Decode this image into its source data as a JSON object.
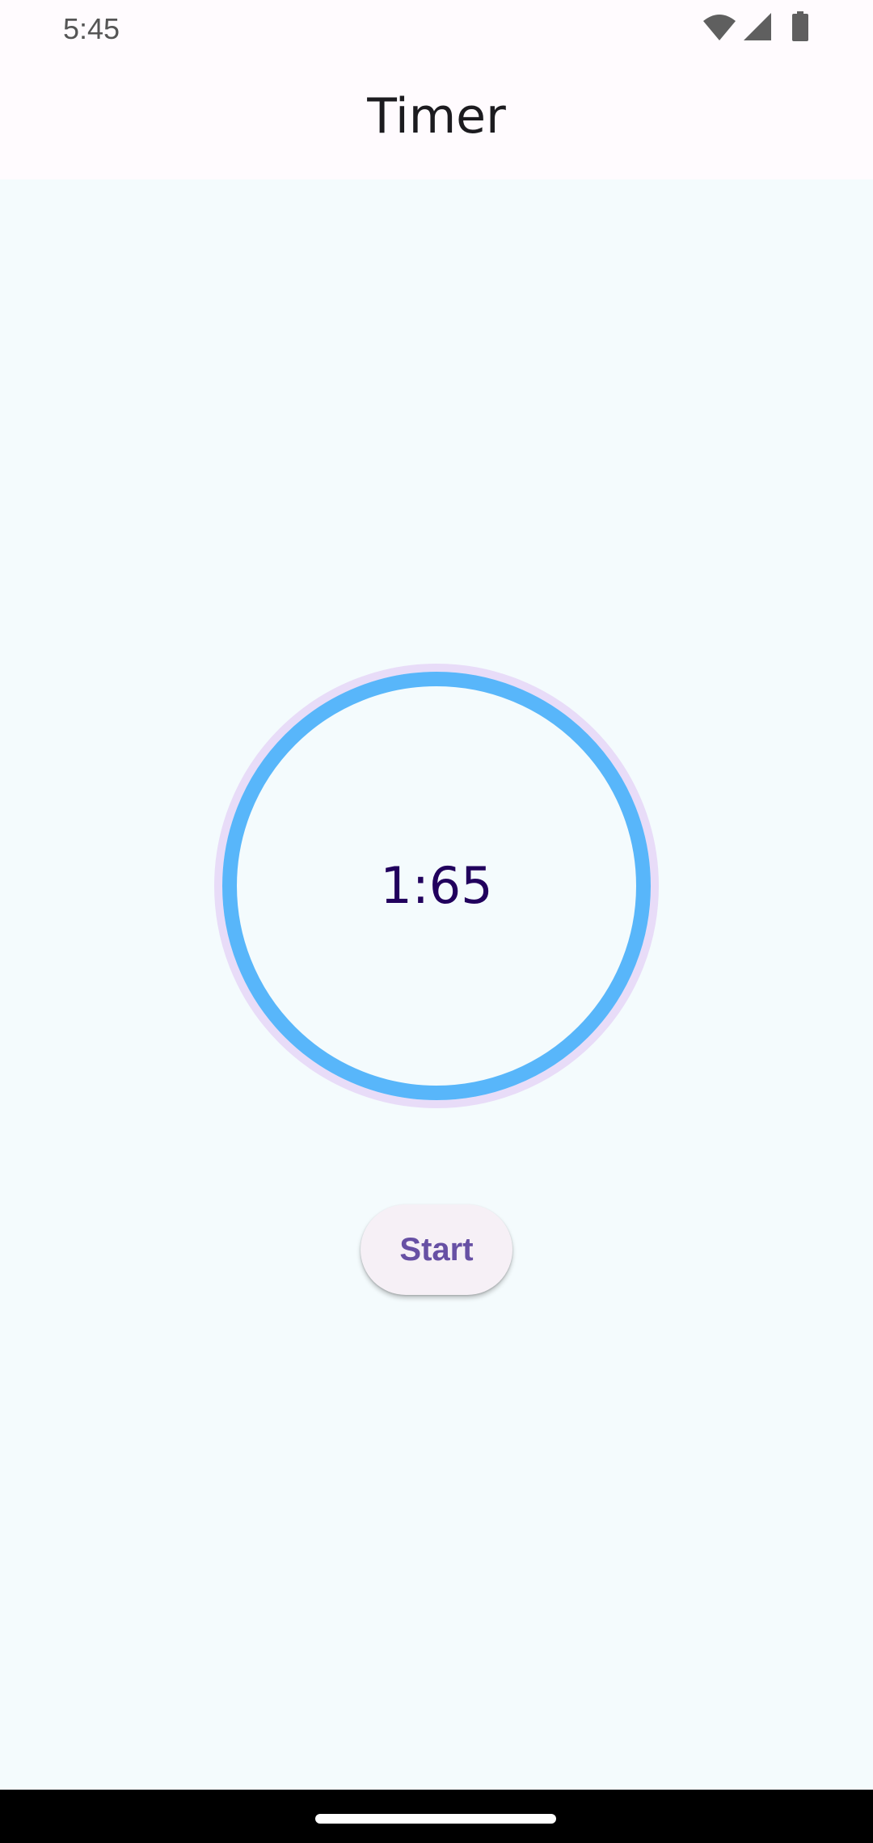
{
  "status_bar": {
    "time": "5:45",
    "icons": [
      "wifi-icon",
      "cellular-signal-icon",
      "battery-icon"
    ]
  },
  "app_bar": {
    "title": "Timer"
  },
  "timer": {
    "value": "1:65",
    "progress": 1.0,
    "ring_color": "#58b6fa",
    "track_color": "#e8dcf8"
  },
  "actions": {
    "start_label": "Start"
  },
  "colors": {
    "background": "#f4fbfd",
    "app_bar": "#fffbfe",
    "accent": "#6750a4",
    "timer_text": "#21005d"
  }
}
